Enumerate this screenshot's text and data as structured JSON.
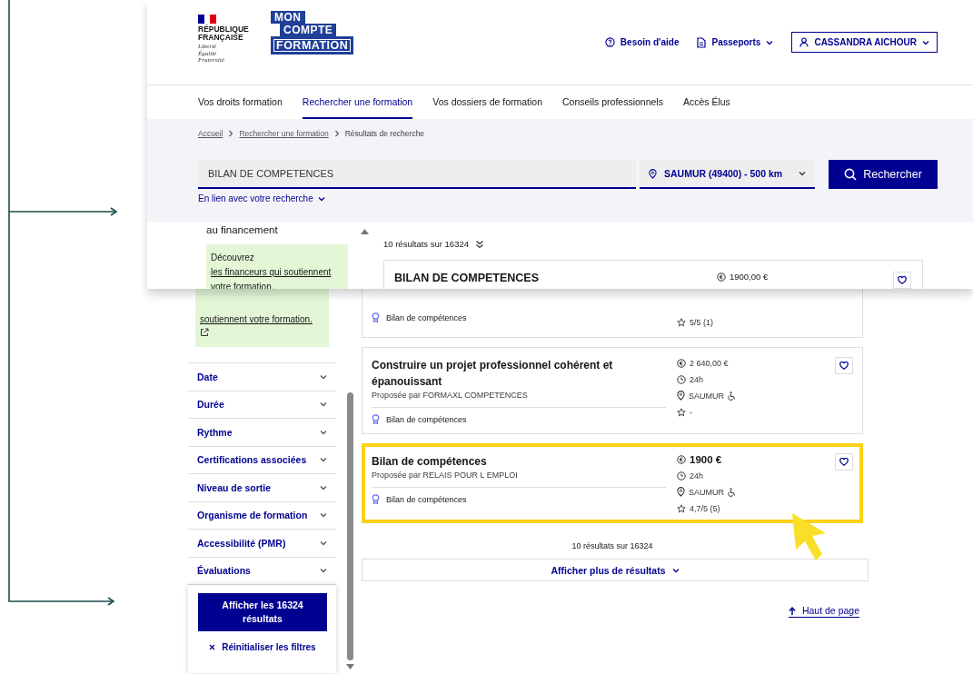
{
  "header": {
    "republic_name": "RÉPUBLIQUE FRANÇAISE",
    "republic_motto": "Liberté Égalité Fraternité",
    "brand": [
      "MON",
      "COMPTE",
      "FORMATION"
    ],
    "links": [
      {
        "kind": "help",
        "label": "Besoin d'aide"
      },
      {
        "kind": "menu",
        "label": "Passeports"
      }
    ],
    "account": "CASSANDRA AICHOUR"
  },
  "nav": [
    {
      "label": "Vos droits formation",
      "selected": false
    },
    {
      "label": "Rechercher une formation",
      "selected": true
    },
    {
      "label": "Vos dossiers de formation",
      "selected": false
    },
    {
      "label": "Conseils professionnels",
      "selected": false
    },
    {
      "label": "Accès Élus",
      "selected": false
    }
  ],
  "breadcrumb": [
    "Accueil",
    "Rechercher une formation",
    "Résultats de recherche"
  ],
  "search": {
    "value": "BILAN DE COMPETENCES",
    "location": "SAUMUR (49400) - 500 km",
    "button": "Rechercher",
    "related": "En lien avec votre recherche"
  },
  "funding_panel": {
    "heading": "au financement",
    "notice_intro": "Découvrez",
    "notice_link": "les financeurs qui soutiennent votre formation."
  },
  "results_preview": {
    "count": "10 résultats sur 16324",
    "first_title": "BILAN DE COMPETENCES",
    "first_price": "1900,00 €"
  },
  "filters": {
    "notice_link": "soutiennent votre formation.",
    "items": [
      "Date",
      "Durée",
      "Rythme",
      "Certifications associées",
      "Niveau de sortie",
      "Organisme de formation",
      "Accessibilité (PMR)",
      "Évaluations"
    ],
    "apply": "Afficher les 16324 résultats",
    "reset": "Réinitialiser les filtres"
  },
  "results": [
    {
      "kind": "partial",
      "certification": "Bilan de compétences",
      "rating": "5/5 (1)",
      "highlighted": false
    },
    {
      "kind": "full",
      "title": "Construire un projet professionnel cohérent et épanouissant",
      "provider": "Proposée par FORMAXL COMPETENCES",
      "price": "2 640,00 €",
      "duration": "24h",
      "location": "SAUMUR",
      "accessible": true,
      "certification": "Bilan de compétences",
      "rating": "-",
      "highlighted": false
    },
    {
      "kind": "full",
      "title": "Bilan de compétences",
      "provider": "Proposée par RELAIS POUR L EMPLOI",
      "price": "1900 €",
      "duration": "24h",
      "location": "SAUMUR",
      "accessible": true,
      "certification": "Bilan de compétences",
      "rating": "4,7/5 (5)",
      "highlighted": true
    }
  ],
  "results_footer": {
    "count": "10 résultats sur 16324",
    "more": "Afficher plus de résultats",
    "back_to_top": "Haut de page"
  }
}
